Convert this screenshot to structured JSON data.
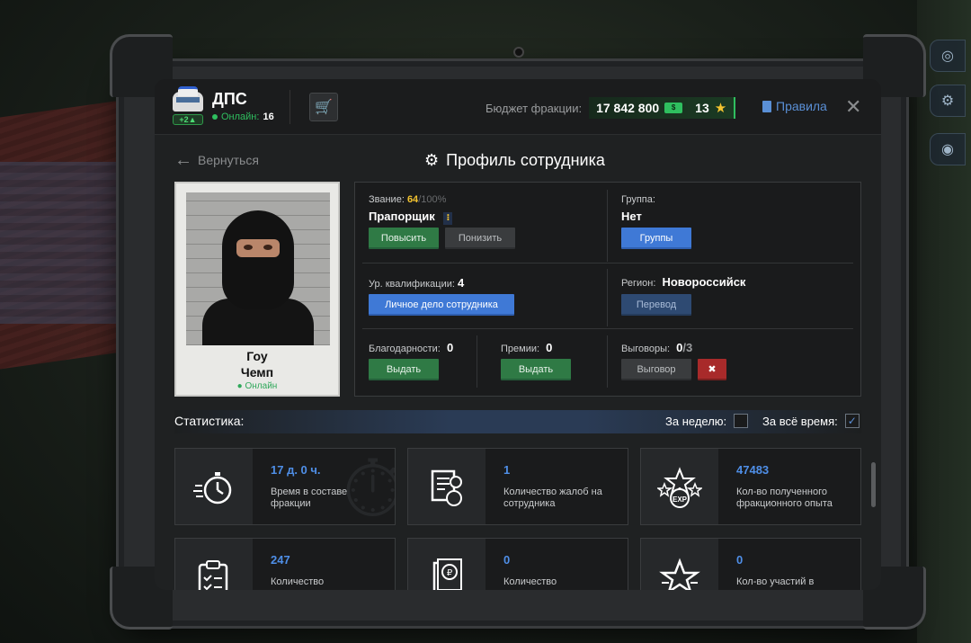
{
  "header": {
    "faction_name": "ДПС",
    "online_label": "Онлайн:",
    "online_count": "16",
    "level_badge": "+2",
    "budget_label": "Бюджет фракции:",
    "budget_value": "17 842 800",
    "stars_value": "13",
    "rules_label": "Правила",
    "close_icon": "close-icon",
    "cart_icon": "cart-icon"
  },
  "nav": {
    "back_label": "Вернуться",
    "page_title": "Профиль сотрудника"
  },
  "profile": {
    "first_name": "Гоу",
    "last_name": "Чемп",
    "status": "Онлайн"
  },
  "info": {
    "rank_label": "Звание:",
    "rank_progress": "64",
    "rank_progress_max": "/100%",
    "rank_name": "Прапорщик",
    "promote_label": "Повысить",
    "demote_label": "Понизить",
    "group_label": "Группа:",
    "group_value": "Нет",
    "groups_button": "Группы",
    "qualification_label": "Ур. квалификации:",
    "qualification_value": "4",
    "personal_file_button": "Личное дело сотрудника",
    "region_label": "Регион:",
    "region_value": "Новороссийск",
    "transfer_button": "Перевод",
    "thanks_label": "Благодарности:",
    "thanks_value": "0",
    "thanks_button": "Выдать",
    "bonus_label": "Премии:",
    "bonus_value": "0",
    "bonus_button": "Выдать",
    "reprimand_label": "Выговоры:",
    "reprimand_value": "0",
    "reprimand_max": "/3",
    "reprimand_button": "Выговор"
  },
  "stats": {
    "title": "Статистика:",
    "week_label": "За неделю:",
    "week_checked": false,
    "all_time_label": "За всё время:",
    "all_time_checked": true,
    "tiles": [
      {
        "value": "17 д. 0 ч.",
        "desc": "Время в составе фракции",
        "icon": "stopwatch-icon"
      },
      {
        "value": "1",
        "desc": "Количество жалоб на сотрудника",
        "icon": "complaint-icon"
      },
      {
        "value": "47483",
        "desc": "Кол-во полученного фракционного опыта",
        "icon": "exp-stars-icon"
      },
      {
        "value": "247",
        "desc": "Количество",
        "icon": "clipboard-icon"
      },
      {
        "value": "0",
        "desc": "Количество",
        "icon": "ruble-document-icon"
      },
      {
        "value": "0",
        "desc": "Кол-во участий в",
        "icon": "star-icon"
      }
    ]
  },
  "colors": {
    "accent_blue": "#4f8fe8",
    "online_green": "#2fbf5f",
    "rank_gold": "#f4c430",
    "danger_red": "#a82a2a"
  }
}
